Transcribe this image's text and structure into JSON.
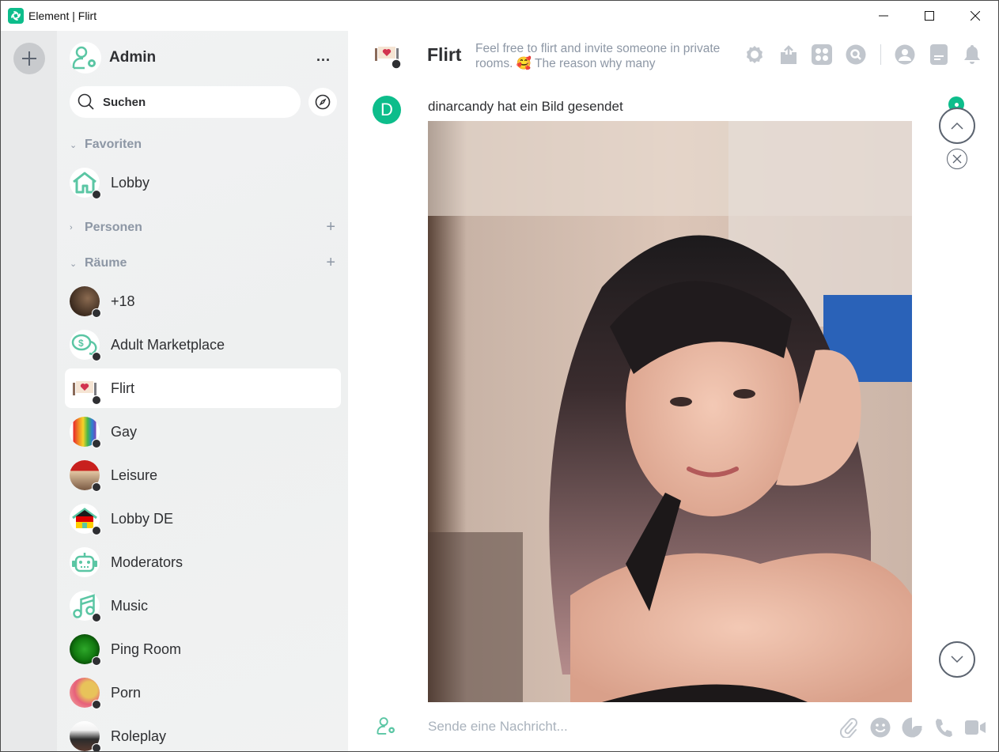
{
  "window": {
    "title": "Element | Flirt",
    "controls": [
      "minimize",
      "maximize",
      "close"
    ]
  },
  "spacebar": {
    "add_space_icon": "plus-icon"
  },
  "sidebar": {
    "user": {
      "name": "Admin",
      "avatar_icon": "user-gear-icon",
      "more_label": "..."
    },
    "search": {
      "placeholder": "Suchen",
      "icon": "search-icon"
    },
    "explore_icon": "compass-icon",
    "sections": {
      "favorites": {
        "label": "Favoriten",
        "expanded": true
      },
      "people": {
        "label": "Personen",
        "expanded": false
      },
      "rooms": {
        "label": "Räume",
        "expanded": true
      }
    },
    "favorites": [
      {
        "name": "Lobby",
        "avatar": "house-icon"
      }
    ],
    "rooms": [
      {
        "name": "+18",
        "avatar": "photo"
      },
      {
        "name": "Adult Marketplace",
        "avatar": "money-chat-icon"
      },
      {
        "name": "Flirt",
        "avatar": "heart-sign",
        "active": true
      },
      {
        "name": "Gay",
        "avatar": "rainbow"
      },
      {
        "name": "Leisure",
        "avatar": "photo"
      },
      {
        "name": "Lobby DE",
        "avatar": "house-de-icon"
      },
      {
        "name": "Moderators",
        "avatar": "robot-icon"
      },
      {
        "name": "Music",
        "avatar": "music-note-icon"
      },
      {
        "name": "Ping Room",
        "avatar": "radar"
      },
      {
        "name": "Porn",
        "avatar": "illustration"
      },
      {
        "name": "Roleplay",
        "avatar": "illustration"
      }
    ]
  },
  "room_header": {
    "name": "Flirt",
    "topic": "Feel free to flirt and invite someone in private rooms. 🥰 The reason why many",
    "icons": [
      "settings-icon",
      "share-icon",
      "apps-icon",
      "search-icon",
      "people-icon",
      "threads-icon",
      "notifications-icon"
    ]
  },
  "timeline": {
    "event": {
      "sender_initial": "D",
      "text": "dinarcandy hat ein Bild gesendet",
      "content_type": "image"
    },
    "jump_to_unread_icon": "chevron-up-icon",
    "dismiss_icon": "close-icon",
    "jump_to_bottom_icon": "chevron-down-icon"
  },
  "composer": {
    "placeholder": "Sende eine Nachricht...",
    "icons": [
      "attachment-icon",
      "emoji-icon",
      "sticker-icon",
      "voice-call-icon",
      "video-call-icon"
    ]
  },
  "colors": {
    "accent": "#0dbd8b",
    "icon_gray": "#c1c6cd",
    "text_secondary": "#8d97a5"
  }
}
